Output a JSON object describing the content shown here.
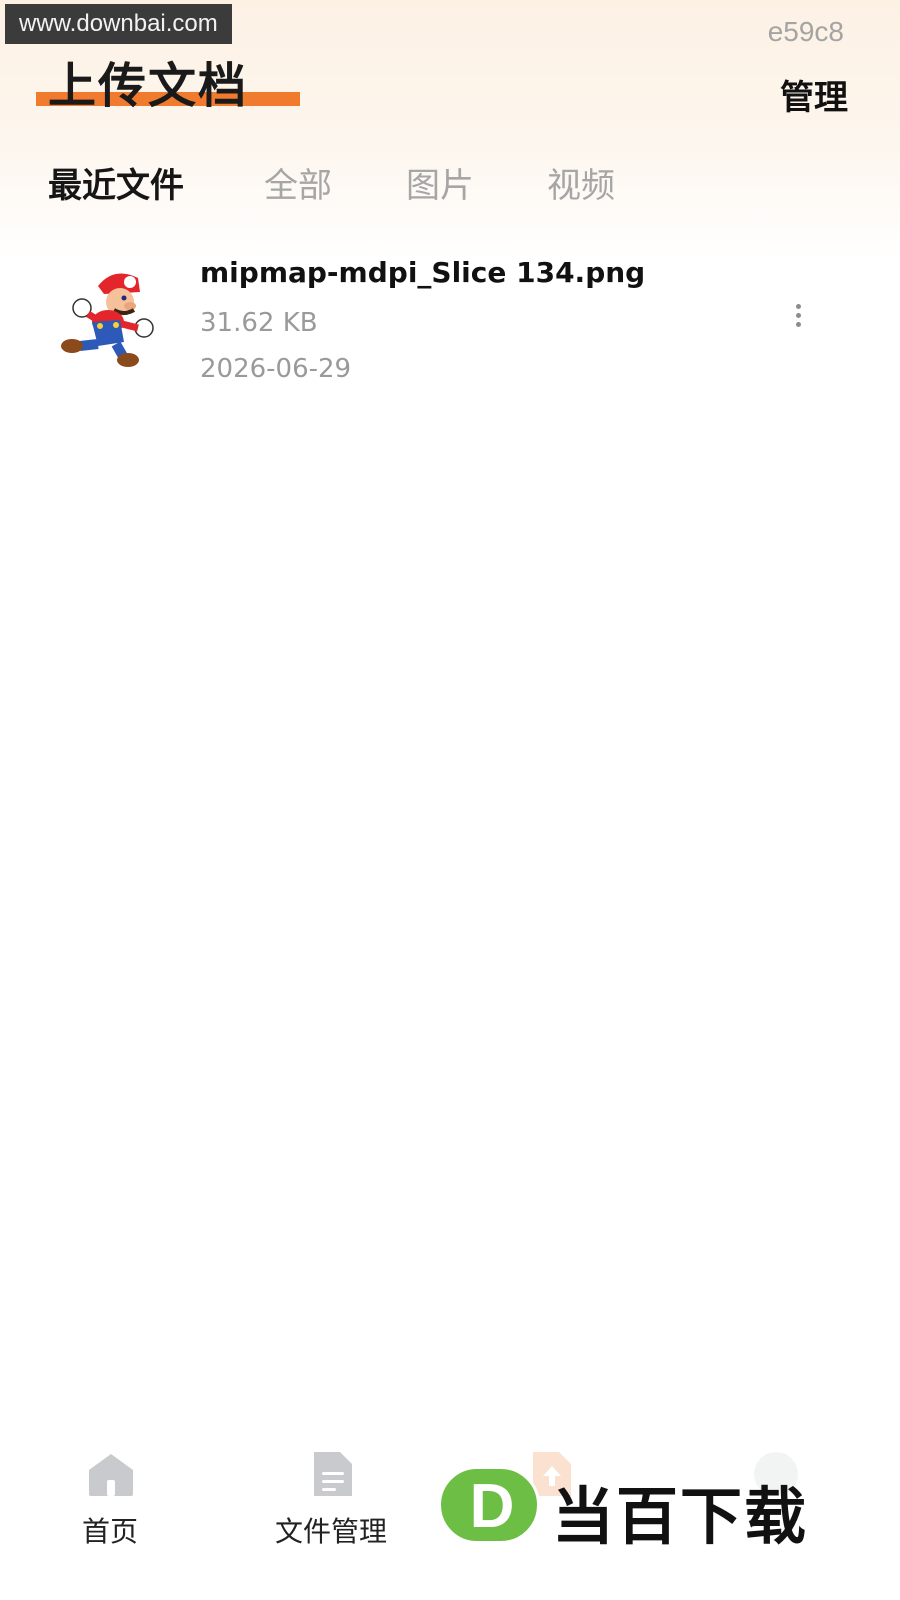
{
  "watermark": {
    "url": "www.downbai.com",
    "code": "e59c8"
  },
  "header": {
    "title": "上传文档",
    "manage_label": "管理"
  },
  "tabs": [
    {
      "label": "最近文件",
      "active": true
    },
    {
      "label": "全部",
      "active": false
    },
    {
      "label": "图片",
      "active": false
    },
    {
      "label": "视频",
      "active": false
    }
  ],
  "files": [
    {
      "name": "mipmap-mdpi_Slice 134.png",
      "size": "31.62 KB",
      "date": "2026-06-29",
      "thumbnail": "mario-character-image",
      "more_icon": "vertical-dots-icon"
    }
  ],
  "bottom_nav": [
    {
      "label": "首页",
      "icon": "home-icon"
    },
    {
      "label": "文件管理",
      "icon": "document-icon"
    },
    {
      "label": "",
      "icon": "upload-icon"
    },
    {
      "label": "",
      "icon": "user-icon"
    }
  ],
  "brand": {
    "letter": "D",
    "text": "当百下载"
  },
  "colors": {
    "accent": "#f07a2e",
    "brand_green": "#6dbe45",
    "muted_text": "#9a9a9a"
  }
}
